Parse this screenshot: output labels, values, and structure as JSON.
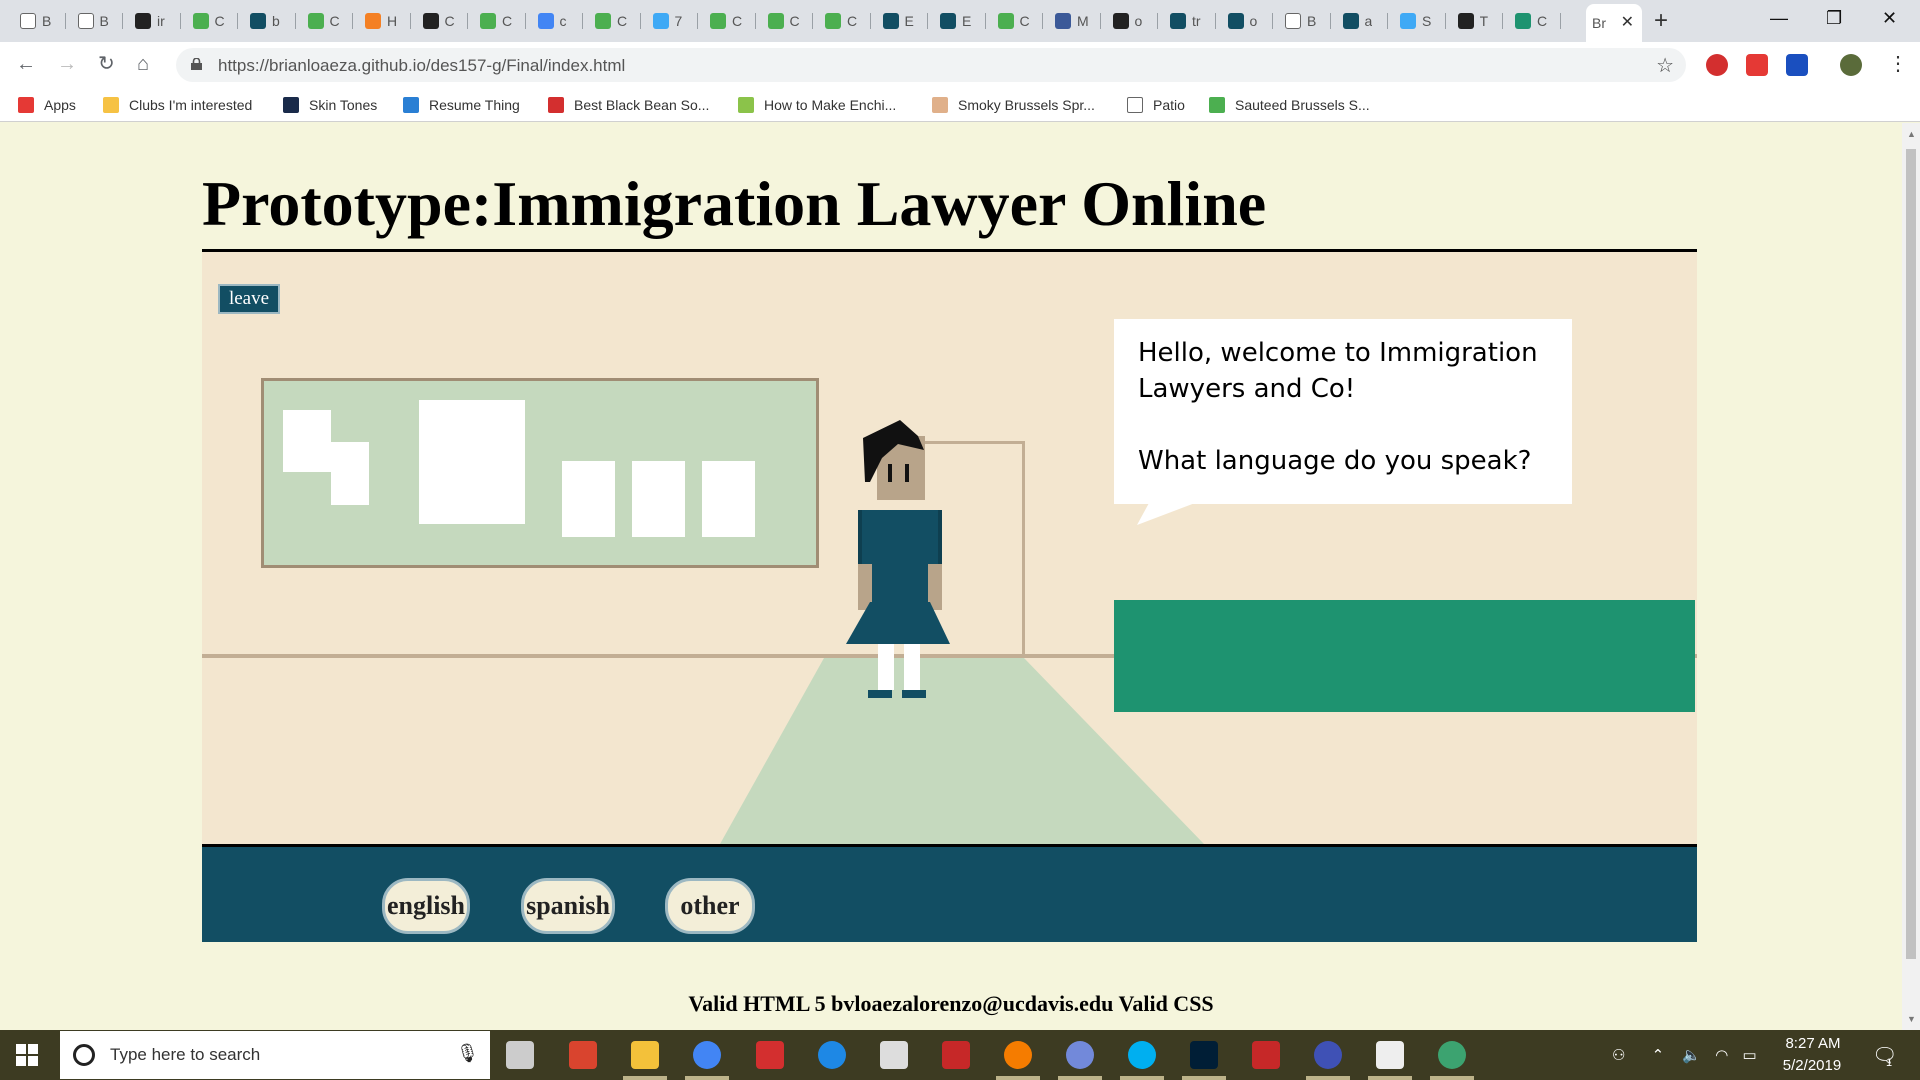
{
  "browser": {
    "tabs": [
      {
        "title": "B",
        "icon": "document-icon",
        "color": "#ffffff"
      },
      {
        "title": "B",
        "icon": "document-icon",
        "color": "#ffffff"
      },
      {
        "title": "ir",
        "icon": "codepen-icon",
        "color": "#222222"
      },
      {
        "title": "C",
        "icon": "w3schools-icon",
        "color": "#4caf50"
      },
      {
        "title": "b",
        "icon": "github-icon",
        "color": "#124e63"
      },
      {
        "title": "C",
        "icon": "w3schools-icon",
        "color": "#4caf50"
      },
      {
        "title": "H",
        "icon": "stackoverflow-icon",
        "color": "#f48024"
      },
      {
        "title": "C",
        "icon": "hexagon-icon",
        "color": "#222222"
      },
      {
        "title": "C",
        "icon": "w3schools-icon",
        "color": "#4caf50"
      },
      {
        "title": "c",
        "icon": "google-icon",
        "color": "#4285f4"
      },
      {
        "title": "C",
        "icon": "w3schools-icon",
        "color": "#4caf50"
      },
      {
        "title": "7",
        "icon": "frame-icon",
        "color": "#3fa9f5"
      },
      {
        "title": "C",
        "icon": "w3schools-icon",
        "color": "#4caf50"
      },
      {
        "title": "C",
        "icon": "w3schools-icon",
        "color": "#4caf50"
      },
      {
        "title": "C",
        "icon": "w3schools-icon",
        "color": "#4caf50"
      },
      {
        "title": "E",
        "icon": "github-icon",
        "color": "#124e63"
      },
      {
        "title": "E",
        "icon": "github-icon",
        "color": "#124e63"
      },
      {
        "title": "C",
        "icon": "w3schools-icon",
        "color": "#4caf50"
      },
      {
        "title": "M",
        "icon": "facebook-icon",
        "color": "#3b5998"
      },
      {
        "title": "o",
        "icon": "codepen-icon",
        "color": "#222222"
      },
      {
        "title": "tr",
        "icon": "github-icon",
        "color": "#124e63"
      },
      {
        "title": "o",
        "icon": "github-icon",
        "color": "#124e63"
      },
      {
        "title": "B",
        "icon": "document-icon",
        "color": "#ffffff"
      },
      {
        "title": "a",
        "icon": "github-icon",
        "color": "#124e63"
      },
      {
        "title": "S",
        "icon": "link-icon",
        "color": "#3fa9f5"
      },
      {
        "title": "T",
        "icon": "panda-icon",
        "color": "#222222"
      },
      {
        "title": "C",
        "icon": "feather-icon",
        "color": "#1e9370"
      }
    ],
    "active_tab": {
      "title": "Br",
      "icon": "none"
    },
    "new_tab_glyph": "+",
    "window_controls": {
      "minimize": "—",
      "maximize": "❐",
      "close": "✕"
    },
    "nav": {
      "back": "←",
      "forward": "→",
      "reload": "↻",
      "home": "⌂"
    },
    "url": "https://brianloaeza.github.io/des157-g/Final/index.html",
    "star_glyph": "☆",
    "menu_glyph": "⋮",
    "extensions": [
      {
        "name": "adblock-icon",
        "color": "#d32f2f"
      },
      {
        "name": "pocket-icon",
        "color": "#e53935"
      },
      {
        "name": "honey-icon",
        "color": "#1a4fbf"
      },
      {
        "name": "avatar-icon",
        "color": "#5a6b3a"
      }
    ],
    "bookmarks": [
      {
        "label": "Apps",
        "icon": "apps-grid-icon",
        "color": "#e53935"
      },
      {
        "label": "Clubs I'm interested",
        "icon": "folder-icon",
        "color": "#f6c244"
      },
      {
        "label": "Skin Tones",
        "icon": "photo-icon",
        "color": "#1a2b4a"
      },
      {
        "label": "Resume Thing",
        "icon": "resume-icon",
        "color": "#2a7fd4"
      },
      {
        "label": "Best Black Bean So...",
        "icon": "nyt-icon",
        "color": "#d32f2f"
      },
      {
        "label": "How to Make Enchi...",
        "icon": "plus-icon",
        "color": "#8bc34a"
      },
      {
        "label": "Smoky Brussels Spr...",
        "icon": "avatar-icon",
        "color": "#e0b08a"
      },
      {
        "label": "Patio",
        "icon": "document-icon",
        "color": "#ffffff"
      },
      {
        "label": "Sauteed Brussels S...",
        "icon": "leaf-icon",
        "color": "#4caf50"
      }
    ]
  },
  "page": {
    "title": "Prototype:Immigration Lawyer Online",
    "leave_label": "leave",
    "speech": {
      "greeting": "Hello, welcome to Immigration Lawyers and Co!",
      "question": "What language do you speak?"
    },
    "language_options": [
      "english",
      "spanish",
      "other"
    ],
    "footer": "Valid HTML 5 bvloaezalorenzo@ucdavis.edu Valid CSS"
  },
  "colors": {
    "page_bg": "#f5f5dc",
    "scene_bg": "#f3e6cf",
    "accent_teal": "#124e63",
    "board_green": "#c5d9be",
    "panel_green": "#1e9370",
    "trim": "#c2ae94"
  },
  "taskbar": {
    "search_placeholder": "Type here to search",
    "apps": [
      {
        "name": "task-view-icon",
        "color": "#cccccc"
      },
      {
        "name": "acrobat-icon",
        "color": "#d9442e"
      },
      {
        "name": "file-explorer-icon",
        "color": "#f3c13a"
      },
      {
        "name": "chrome-icon",
        "color": "#4285f4"
      },
      {
        "name": "reader-icon",
        "color": "#d32f2f"
      },
      {
        "name": "edge-icon",
        "color": "#1e88e5"
      },
      {
        "name": "mail-icon",
        "color": "#dddddd"
      },
      {
        "name": "mcafee-icon",
        "color": "#c62828"
      },
      {
        "name": "app-orange-icon",
        "color": "#f57c00"
      },
      {
        "name": "discord-icon",
        "color": "#7289da"
      },
      {
        "name": "skype-icon",
        "color": "#00aff0"
      },
      {
        "name": "photoshop-icon",
        "color": "#001e36"
      },
      {
        "name": "mcafee-shield-icon",
        "color": "#c62828"
      },
      {
        "name": "browser-app-icon",
        "color": "#3f51b5"
      },
      {
        "name": "photos-icon",
        "color": "#eeeeee"
      },
      {
        "name": "atom-icon",
        "color": "#3ca370"
      }
    ],
    "time": "8:27 AM",
    "date": "5/2/2019",
    "notification_count": "1"
  }
}
